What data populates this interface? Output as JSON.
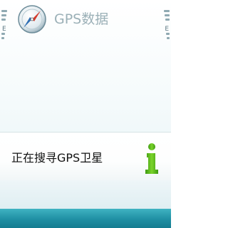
{
  "app": {
    "title": "GPS数据",
    "icon": "compass-icon"
  },
  "status": {
    "signal_icon": "signal-strength-icon",
    "signal_label": "E",
    "battery_icon": "battery-level-icon",
    "battery_label": "E"
  },
  "dialog": {
    "message": "正在搜寻GPS卫星",
    "icon": "info-icon"
  },
  "colors": {
    "bottom_bar": "#1f8fa3",
    "title_text": "#9bb0b7",
    "info_icon_green": "#5cb81c"
  }
}
